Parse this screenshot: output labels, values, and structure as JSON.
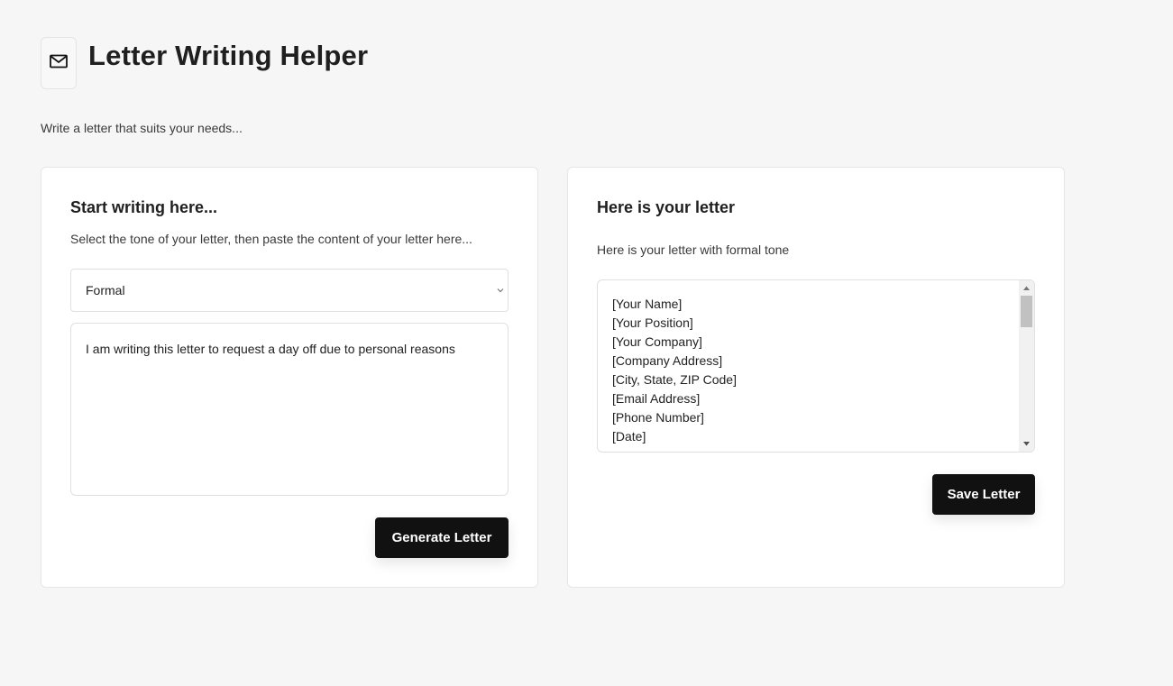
{
  "app": {
    "title": "Letter Writing Helper",
    "subtitle": "Write a letter that suits your needs...",
    "logo_icon": "mail-icon"
  },
  "input_panel": {
    "title": "Start writing here...",
    "description": "Select the tone of your letter, then paste the content of your letter here...",
    "tone_select": {
      "value": "Formal"
    },
    "letter_content": "I am writing this letter to request a day off due to personal reasons",
    "generate_button": "Generate Letter"
  },
  "output_panel": {
    "title": "Here is your letter",
    "description": "Here is your letter with formal tone",
    "letter_lines": [
      "[Your Name]",
      "[Your Position]",
      "[Your Company]",
      "[Company Address]",
      "[City, State, ZIP Code]",
      "[Email Address]",
      "[Phone Number]",
      "[Date]"
    ],
    "save_button": "Save Letter"
  },
  "colors": {
    "page_background": "#f6f6f6",
    "card_background": "#ffffff",
    "button_background": "#111111",
    "button_text": "#ffffff"
  }
}
